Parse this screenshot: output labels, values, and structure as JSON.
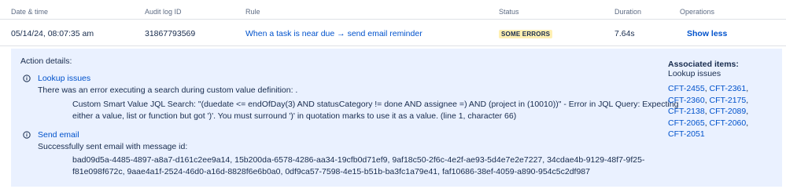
{
  "table": {
    "headers": {
      "date": "Date & time",
      "audit_id": "Audit log ID",
      "rule": "Rule",
      "status": "Status",
      "duration": "Duration",
      "operations": "Operations"
    },
    "row": {
      "date": "05/14/24, 08:07:35 am",
      "audit_id": "31867793569",
      "rule": "When a task is near due → send email reminder",
      "status": "SOME ERRORS",
      "duration": "7.64s",
      "operation": "Show less"
    }
  },
  "details": {
    "title": "Action details:",
    "lookup": {
      "title": "Lookup issues",
      "message": "There was an error executing a search during custom value definition: .",
      "detail_line1": "Custom Smart Value JQL Search: \"(duedate <= endOfDay(3) AND statusCategory != done AND assignee =) AND (project in (10010))\" - Error in JQL Query: Expecting",
      "detail_line2": "either a value, list or function but got ')'. You must surround ')' in quotation marks to use it as a value. (line 1, character 66)"
    },
    "email": {
      "title": "Send email",
      "message": "Successfully sent email with message id:",
      "ids_line1": "bad09d5a-4485-4897-a8a7-d161c2ee9a14, 15b200da-6578-4286-aa34-19cfb0d71ef9, 9af18c50-2f6c-4e2f-ae93-5d4e7e2e7227, 34cdae4b-9129-48f7-9f25-",
      "ids_line2": "f81e098f672c, 9aae4a1f-2524-46d0-a16d-8828f6e6b0a0, 0df9ca57-7598-4e15-b51b-ba3fc1a79e41, faf10686-38ef-4059-a890-954c5c2df987"
    },
    "associated": {
      "title": "Associated items:",
      "subtitle": "Lookup issues",
      "lines": [
        [
          "CFT-2455",
          "CFT-2361"
        ],
        [
          "CFT-2360",
          "CFT-2175"
        ],
        [
          "CFT-2138",
          "CFT-2089"
        ],
        [
          "CFT-2065",
          "CFT-2060"
        ],
        [
          "CFT-2051"
        ]
      ]
    }
  },
  "colors": {
    "link": "#0052cc",
    "panel_bg": "#eaf1ff",
    "badge_bg": "#fff0b3",
    "text": "#172b4d",
    "muted": "#5e6c84"
  },
  "icons": {
    "info": "info-icon"
  }
}
